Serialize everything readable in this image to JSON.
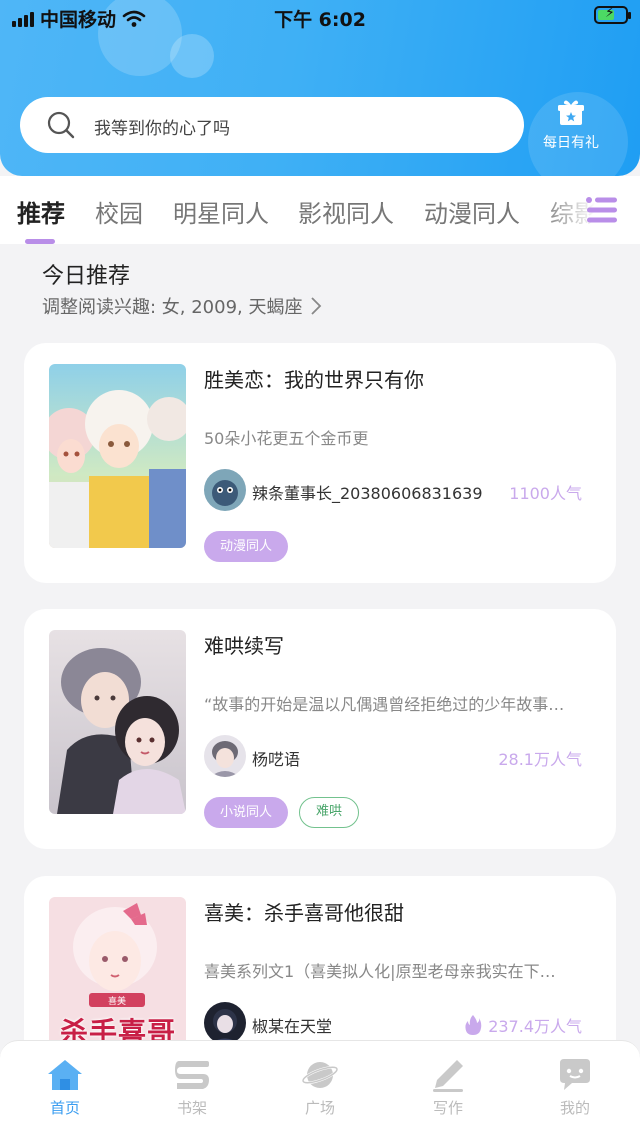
{
  "status_bar": {
    "carrier": "中国移动",
    "time": "下午 6:02"
  },
  "search": {
    "placeholder": "我等到你的心了吗"
  },
  "daily_gift": {
    "label": "每日有礼"
  },
  "tabs": [
    {
      "label": "推荐",
      "active": true
    },
    {
      "label": "校园",
      "active": false
    },
    {
      "label": "明星同人",
      "active": false
    },
    {
      "label": "影视同人",
      "active": false
    },
    {
      "label": "动漫同人",
      "active": false
    },
    {
      "label": "综影",
      "active": false
    }
  ],
  "section": {
    "title": "今日推荐",
    "subtitle": "调整阅读兴趣: 女, 2009, 天蝎座"
  },
  "cards": [
    {
      "title": "胜美恋：我的世界只有你",
      "description": "50朵小花更五个金币更",
      "author": "辣条董事长_20380606831639",
      "popularity": "1100人气",
      "hot": false,
      "tags": [
        {
          "label": "动漫同人",
          "style": "purple"
        }
      ]
    },
    {
      "title": "难哄续写",
      "description": "“故事的开始是温以凡偶遇曾经拒绝过的少年故事…",
      "author": "杨呓语",
      "popularity": "28.1万人气",
      "hot": false,
      "tags": [
        {
          "label": "小说同人",
          "style": "purple"
        },
        {
          "label": "难哄",
          "style": "green"
        }
      ]
    },
    {
      "title": "喜美：杀手喜哥他很甜",
      "description": "喜美系列文1（喜美拟人化|原型老母亲我实在下…",
      "author": "椒某在天堂",
      "popularity": "237.4万人气",
      "hot": true,
      "cover_text": "杀手喜哥",
      "cover_badge": "喜美",
      "tags": []
    }
  ],
  "bottom_nav": [
    {
      "label": "首页",
      "icon": "home-icon",
      "active": true
    },
    {
      "label": "书架",
      "icon": "bookshelf-icon",
      "active": false
    },
    {
      "label": "广场",
      "icon": "planet-icon",
      "active": false
    },
    {
      "label": "写作",
      "icon": "pen-icon",
      "active": false
    },
    {
      "label": "我的",
      "icon": "chat-bubble-icon",
      "active": false
    }
  ],
  "colors": {
    "header_blue": "#3fb0f5",
    "accent_purple": "#c9a9ec",
    "tag_green": "#73c28e",
    "nav_active": "#3a9df0"
  }
}
